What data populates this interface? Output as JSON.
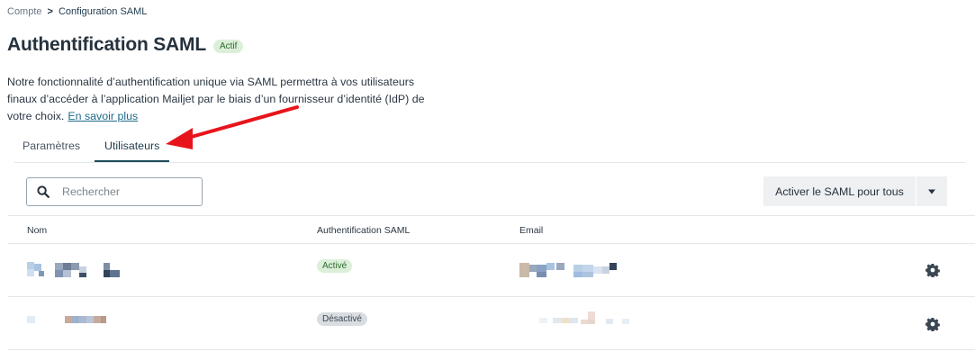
{
  "breadcrumb": {
    "parent": "Compte",
    "separator": ">",
    "current": "Configuration SAML"
  },
  "header": {
    "title": "Authentification SAML",
    "badge": "Actif"
  },
  "description": {
    "text": "Notre fonctionnalité d’authentification unique via SAML permettra à vos utilisateurs finaux d’accéder à l’application Mailjet par le biais d’un fournisseur d’identité (IdP) de votre choix.",
    "link": "En savoir plus"
  },
  "tabs": [
    {
      "label": "Paramètres",
      "active": false
    },
    {
      "label": "Utilisateurs",
      "active": true
    }
  ],
  "search": {
    "placeholder": "Rechercher",
    "value": ""
  },
  "actions": {
    "enable_all_label": "Activer le SAML pour tous"
  },
  "table": {
    "columns": [
      "Nom",
      "Authentification SAML",
      "Email"
    ],
    "rows": [
      {
        "name": "",
        "saml_status": "Activé",
        "status_kind": "on",
        "email": ""
      },
      {
        "name": "",
        "saml_status": "Désactivé",
        "status_kind": "off",
        "email": ""
      }
    ]
  },
  "colors": {
    "accent": "#1f4d5c",
    "annotation_arrow": "#e8141b",
    "active_badge_bg": "#dcefd9",
    "inactive_badge_bg": "#d9dde1"
  },
  "icons": {
    "search": "search-icon",
    "dropdown": "chevron-down-icon",
    "row_settings": "gear-icon"
  }
}
